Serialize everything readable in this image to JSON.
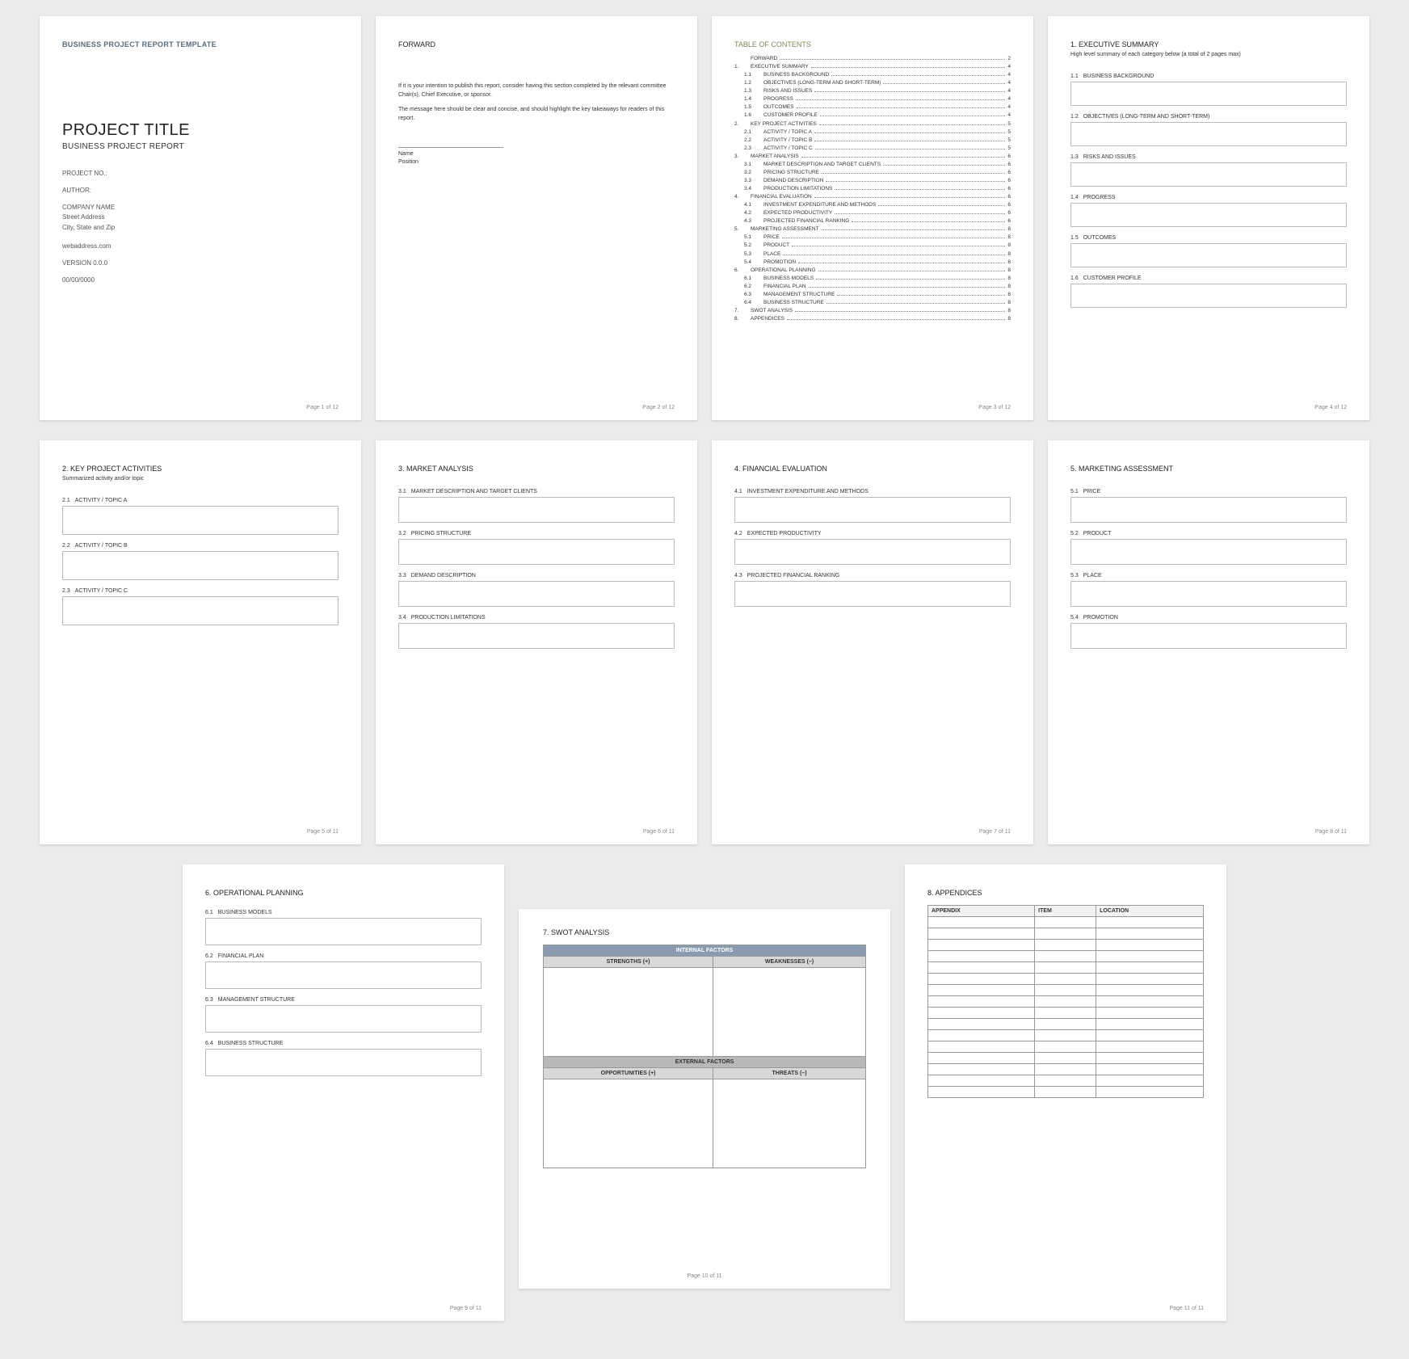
{
  "page1": {
    "header": "BUSINESS PROJECT REPORT TEMPLATE",
    "title": "PROJECT TITLE",
    "subtitle": "BUSINESS PROJECT REPORT",
    "project_no_label": "PROJECT NO.:",
    "author_label": "AUTHOR:",
    "company": "COMPANY NAME",
    "street": "Street Address",
    "city": "City, State and Zip",
    "web": "webaddress.com",
    "version": "VERSION 0.0.0",
    "date": "00/00/0000",
    "footer": "Page 1 of 12"
  },
  "page2": {
    "heading": "FORWARD",
    "p1": "If it is your intention to publish this report, consider having this section completed by the relevant committee Chair(s), Chief Executive, or sponsor.",
    "p2": "The message here should be clear and concise, and should highlight the key takeaways for readers of this report.",
    "name_label": "Name",
    "position_label": "Position",
    "footer": "Page 2 of 12"
  },
  "page3": {
    "heading": "TABLE OF CONTENTS",
    "items": [
      {
        "n": "",
        "label": "FORWARD",
        "pg": "2",
        "sub": false
      },
      {
        "n": "1.",
        "label": "EXECUTIVE SUMMARY",
        "pg": "4",
        "sub": false
      },
      {
        "n": "1.1",
        "label": "BUSINESS BACKGROUND",
        "pg": "4",
        "sub": true
      },
      {
        "n": "1.2",
        "label": "OBJECTIVES (LONG-TERM AND SHORT-TERM)",
        "pg": "4",
        "sub": true
      },
      {
        "n": "1.3",
        "label": "RISKS AND ISSUES",
        "pg": "4",
        "sub": true
      },
      {
        "n": "1.4",
        "label": "PROGRESS",
        "pg": "4",
        "sub": true
      },
      {
        "n": "1.5",
        "label": "OUTCOMES",
        "pg": "4",
        "sub": true
      },
      {
        "n": "1.6",
        "label": "CUSTOMER PROFILE",
        "pg": "4",
        "sub": true
      },
      {
        "n": "2.",
        "label": "KEY PROJECT ACTIVITIES",
        "pg": "5",
        "sub": false
      },
      {
        "n": "2.1",
        "label": "ACTIVITY / TOPIC A",
        "pg": "5",
        "sub": true
      },
      {
        "n": "2.2",
        "label": "ACTIVITY / TOPIC B",
        "pg": "5",
        "sub": true
      },
      {
        "n": "2.3",
        "label": "ACTIVITY / TOPIC C",
        "pg": "5",
        "sub": true
      },
      {
        "n": "3.",
        "label": "MARKET ANALYSIS",
        "pg": "6",
        "sub": false
      },
      {
        "n": "3.1",
        "label": "MARKET DESCRIPTION AND TARGET CLIENTS",
        "pg": "6",
        "sub": true
      },
      {
        "n": "3.2",
        "label": "PRICING STRUCTURE",
        "pg": "6",
        "sub": true
      },
      {
        "n": "3.3",
        "label": "DEMAND DESCRIPTION",
        "pg": "6",
        "sub": true
      },
      {
        "n": "3.4",
        "label": "PRODUCTION LIMITATIONS",
        "pg": "6",
        "sub": true
      },
      {
        "n": "4.",
        "label": "FINANCIAL EVALUATION",
        "pg": "6",
        "sub": false
      },
      {
        "n": "4.1",
        "label": "INVESTMENT EXPENDITURE AND METHODS",
        "pg": "6",
        "sub": true
      },
      {
        "n": "4.2",
        "label": "EXPECTED PRODUCTIVITY",
        "pg": "6",
        "sub": true
      },
      {
        "n": "4.3",
        "label": "PROJECTED FINANCIAL RANKING",
        "pg": "6",
        "sub": true
      },
      {
        "n": "5.",
        "label": "MARKETING ASSESSMENT",
        "pg": "8",
        "sub": false
      },
      {
        "n": "5.1",
        "label": "PRICE",
        "pg": "8",
        "sub": true
      },
      {
        "n": "5.2",
        "label": "PRODUCT",
        "pg": "8",
        "sub": true
      },
      {
        "n": "5.3",
        "label": "PLACE",
        "pg": "8",
        "sub": true
      },
      {
        "n": "5.4",
        "label": "PROMOTION",
        "pg": "8",
        "sub": true
      },
      {
        "n": "6.",
        "label": "OPERATIONAL PLANNING",
        "pg": "8",
        "sub": false
      },
      {
        "n": "6.1",
        "label": "BUSINESS MODELS",
        "pg": "8",
        "sub": true
      },
      {
        "n": "6.2",
        "label": "FINANCIAL PLAN",
        "pg": "8",
        "sub": true
      },
      {
        "n": "6.3",
        "label": "MANAGEMENT STRUCTURE",
        "pg": "8",
        "sub": true
      },
      {
        "n": "6.4",
        "label": "BUSINESS STRUCTURE",
        "pg": "8",
        "sub": true
      },
      {
        "n": "7.",
        "label": "SWOT ANALYSIS",
        "pg": "8",
        "sub": false
      },
      {
        "n": "8.",
        "label": "APPENDICES",
        "pg": "8",
        "sub": false
      }
    ],
    "footer": "Page 3 of 12"
  },
  "page4": {
    "heading": "1.  EXECUTIVE SUMMARY",
    "sub": "High level summary of each category below (a total of 2 pages max)",
    "fields": [
      {
        "n": "1.1",
        "label": "BUSINESS BACKGROUND"
      },
      {
        "n": "1.2",
        "label": "OBJECTIVES (LONG-TERM AND SHORT-TERM)"
      },
      {
        "n": "1.3",
        "label": "RISKS AND ISSUES"
      },
      {
        "n": "1.4",
        "label": "PROGRESS"
      },
      {
        "n": "1.5",
        "label": "OUTCOMES"
      },
      {
        "n": "1.6",
        "label": "CUSTOMER PROFILE"
      }
    ],
    "footer": "Page 4 of 12"
  },
  "page5": {
    "heading": "2.  KEY PROJECT ACTIVITIES",
    "sub": "Summarized activity and/or topic",
    "fields": [
      {
        "n": "2.1",
        "label": "ACTIVITY / TOPIC A"
      },
      {
        "n": "2.2",
        "label": "ACTIVITY / TOPIC B"
      },
      {
        "n": "2.3",
        "label": "ACTIVITY / TOPIC C"
      }
    ],
    "footer": "Page 5 of 11"
  },
  "page6": {
    "heading": "3.  MARKET ANALYSIS",
    "fields": [
      {
        "n": "3.1",
        "label": "MARKET DESCRIPTION AND TARGET CLIENTS"
      },
      {
        "n": "3.2",
        "label": "PRICING STRUCTURE"
      },
      {
        "n": "3.3",
        "label": "DEMAND DESCRIPTION"
      },
      {
        "n": "3.4",
        "label": "PRODUCTION LIMITATIONS"
      }
    ],
    "footer": "Page 6 of 11"
  },
  "page7": {
    "heading": "4.  FINANCIAL EVALUATION",
    "fields": [
      {
        "n": "4.1",
        "label": "INVESTMENT EXPENDITURE AND METHODS"
      },
      {
        "n": "4.2",
        "label": "EXPECTED PRODUCTIVITY"
      },
      {
        "n": "4.3",
        "label": "PROJECTED FINANCIAL RANKING"
      }
    ],
    "footer": "Page 7 of 11"
  },
  "page8": {
    "heading": "5.  MARKETING ASSESSMENT",
    "fields": [
      {
        "n": "5.1",
        "label": "PRICE"
      },
      {
        "n": "5.2",
        "label": "PRODUCT"
      },
      {
        "n": "5.3",
        "label": "PLACE"
      },
      {
        "n": "5.4",
        "label": "PROMOTION"
      }
    ],
    "footer": "Page 8 of 11"
  },
  "page9": {
    "heading": "6.  OPERATIONAL PLANNING",
    "fields": [
      {
        "n": "6.1",
        "label": "BUSINESS MODELS"
      },
      {
        "n": "6.2",
        "label": "FINANCIAL PLAN"
      },
      {
        "n": "6.3",
        "label": "MANAGEMENT STRUCTURE"
      },
      {
        "n": "6.4",
        "label": "BUSINESS STRUCTURE"
      }
    ],
    "footer": "Page 9 of 11"
  },
  "page10": {
    "heading": "7.  SWOT ANALYSIS",
    "internal": "INTERNAL FACTORS",
    "external": "EXTERNAL FACTORS",
    "strengths": "STRENGTHS (+)",
    "weaknesses": "WEAKNESSES (–)",
    "opportunities": "OPPORTUNITIES (+)",
    "threats": "THREATS (–)",
    "footer": "Page 10 of 11"
  },
  "page11": {
    "heading": "8.  APPENDICES",
    "cols": [
      "APPENDIX",
      "ITEM",
      "LOCATION"
    ],
    "rows": 16,
    "footer": "Page 11 of 11"
  }
}
